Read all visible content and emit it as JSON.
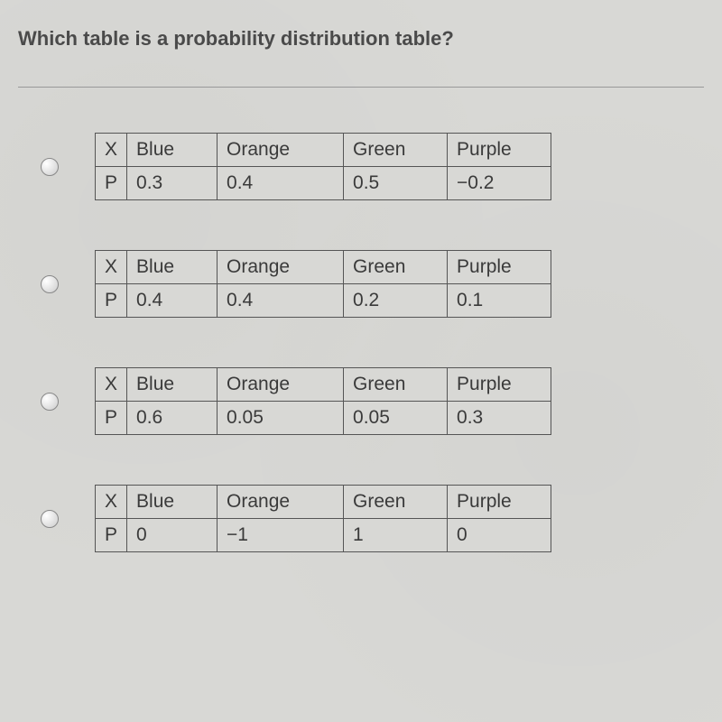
{
  "question": "Which table is a probability distribution table?",
  "columns": [
    "X",
    "Blue",
    "Orange",
    "Green",
    "Purple"
  ],
  "row_label": "P",
  "options": [
    {
      "values": [
        "0.3",
        "0.4",
        "0.5",
        "−0.2"
      ]
    },
    {
      "values": [
        "0.4",
        "0.4",
        "0.2",
        "0.1"
      ]
    },
    {
      "values": [
        "0.6",
        "0.05",
        "0.05",
        "0.3"
      ]
    },
    {
      "values": [
        "0",
        "−1",
        "1",
        "0"
      ]
    }
  ],
  "chart_data": [
    {
      "type": "table",
      "headers": [
        "X",
        "Blue",
        "Orange",
        "Green",
        "Purple"
      ],
      "rows": [
        [
          "P",
          "0.3",
          "0.4",
          "0.5",
          "-0.2"
        ]
      ]
    },
    {
      "type": "table",
      "headers": [
        "X",
        "Blue",
        "Orange",
        "Green",
        "Purple"
      ],
      "rows": [
        [
          "P",
          "0.4",
          "0.4",
          "0.2",
          "0.1"
        ]
      ]
    },
    {
      "type": "table",
      "headers": [
        "X",
        "Blue",
        "Orange",
        "Green",
        "Purple"
      ],
      "rows": [
        [
          "P",
          "0.6",
          "0.05",
          "0.05",
          "0.3"
        ]
      ]
    },
    {
      "type": "table",
      "headers": [
        "X",
        "Blue",
        "Orange",
        "Green",
        "Purple"
      ],
      "rows": [
        [
          "P",
          "0",
          "-1",
          "1",
          "0"
        ]
      ]
    }
  ]
}
